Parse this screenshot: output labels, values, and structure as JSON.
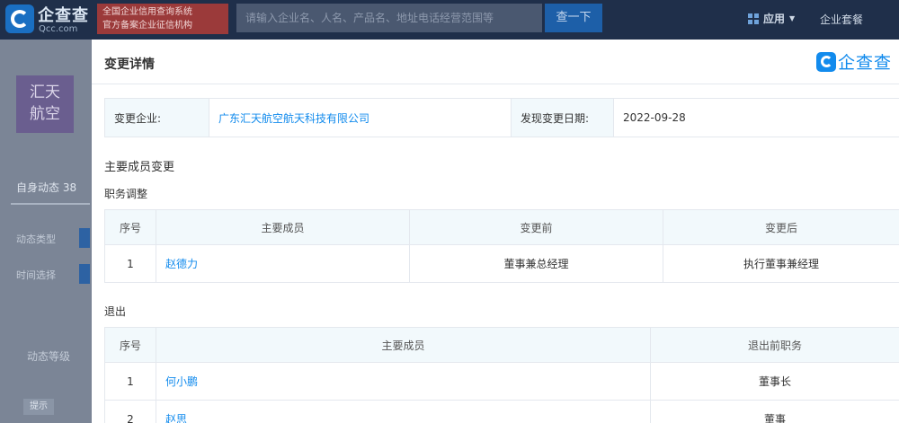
{
  "topbar": {
    "logo_text": "企查查",
    "logo_sub": "Qcc.com",
    "promo_line1": "全国企业信用查询系统",
    "promo_line2": "官方备案企业征信机构",
    "search_placeholder": "请输入企业名、人名、产品名、地址电话经营范围等",
    "search_button": "查一下",
    "apps_label": "应用",
    "suite_label": "企业套餐"
  },
  "background_page": {
    "company_logo_text": "汇天航空",
    "tab_label": "自身动态 38",
    "filter_type_label": "动态类型",
    "filter_time_label": "时间选择",
    "level_label": "动态等级",
    "tag_label": "提示"
  },
  "modal": {
    "title": "变更详情",
    "brand_text": "企查查",
    "info": {
      "company_label": "变更企业:",
      "company_value": "广东汇天航空航天科技有限公司",
      "date_label": "发现变更日期:",
      "date_value": "2022-09-28"
    },
    "section_title": "主要成员变更",
    "role_change": {
      "title": "职务调整",
      "headers": [
        "序号",
        "主要成员",
        "变更前",
        "变更后"
      ],
      "rows": [
        {
          "no": "1",
          "name": "赵德力",
          "before": "董事兼总经理",
          "after": "执行董事兼经理"
        }
      ]
    },
    "exit": {
      "title": "退出",
      "headers": [
        "序号",
        "主要成员",
        "退出前职务"
      ],
      "rows": [
        {
          "no": "1",
          "name": "何小鹏",
          "role": "董事长"
        },
        {
          "no": "2",
          "name": "赵思",
          "role": "董事"
        }
      ]
    }
  },
  "colors": {
    "accent": "#128bed",
    "header_bg": "#f2f9fc",
    "overlay_bg": "#7b8596"
  }
}
